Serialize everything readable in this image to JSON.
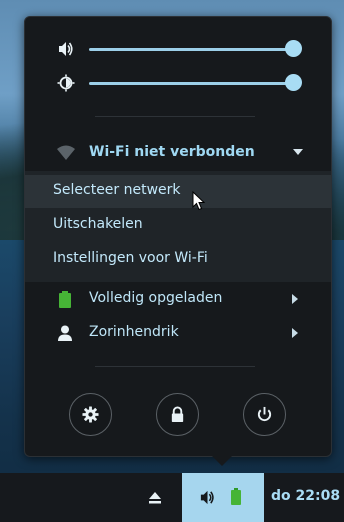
{
  "system_menu": {
    "sliders": {
      "volume_icon": "speaker-icon",
      "volume_level": 0.93,
      "brightness_icon": "brightness-icon",
      "brightness_level": 0.93
    },
    "wifi": {
      "icon": "wifi-icon",
      "label": "Wi-Fi niet verbonden",
      "expanded": true,
      "items": [
        {
          "label": "Selecteer netwerk"
        },
        {
          "label": "Uitschakelen"
        },
        {
          "label": "Instellingen voor Wi-Fi"
        }
      ]
    },
    "battery": {
      "icon": "battery-icon",
      "label": "Volledig opgeladen"
    },
    "user": {
      "icon": "user-icon",
      "label": "Zorinhendrik"
    },
    "actions": [
      {
        "name": "settings",
        "icon": "gear-icon"
      },
      {
        "name": "lock",
        "icon": "lock-icon"
      },
      {
        "name": "power",
        "icon": "power-icon"
      }
    ]
  },
  "taskbar": {
    "eject_icon": "eject-icon",
    "volume_icon": "speaker-icon",
    "battery_icon": "battery-icon",
    "clock": "do 22:08"
  },
  "colors": {
    "accent": "#9fd8f2",
    "battery_green": "#46b436",
    "menu_bg": "#16191c"
  }
}
